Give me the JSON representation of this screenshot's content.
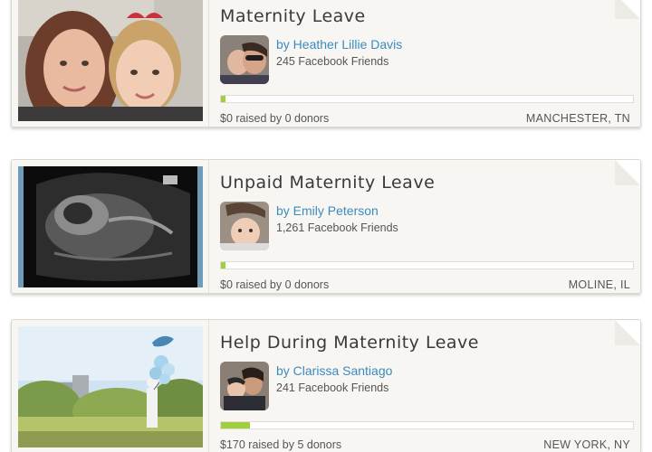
{
  "campaigns": [
    {
      "title": "Maternity Leave",
      "author": "by Heather Lillie Davis",
      "friends": "245 Facebook Friends",
      "raised": "$0 raised by 0 donors",
      "location": "MANCHESTER, TN",
      "progress": 0.01
    },
    {
      "title": "Unpaid Maternity Leave",
      "author": "by Emily Peterson",
      "friends": "1,261 Facebook Friends",
      "raised": "$0 raised by 0 donors",
      "location": "MOLINE, IL",
      "progress": 0.01
    },
    {
      "title": "Help During Maternity Leave",
      "author": "by Clarissa Santiago",
      "friends": "241 Facebook Friends",
      "raised": "$170 raised by 5 donors",
      "location": "NEW YORK, NY",
      "progress": 0.07
    }
  ],
  "colors": {
    "link": "#3a8bbf",
    "progress_fill": "#9fcf3c",
    "card_bg": "#f7f6f2"
  }
}
